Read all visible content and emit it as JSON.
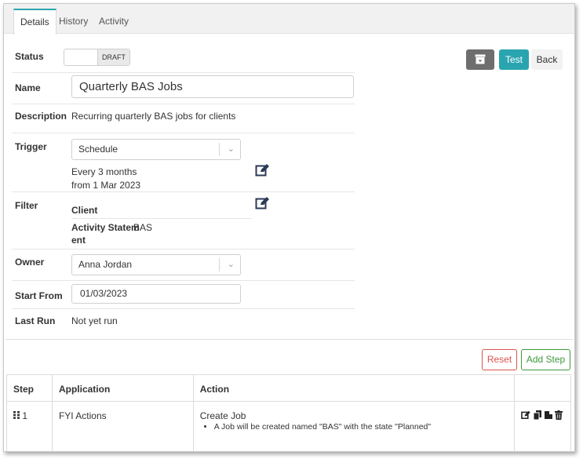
{
  "tabs": [
    {
      "label": "Details",
      "active": true
    },
    {
      "label": "History",
      "active": false
    },
    {
      "label": "Activity",
      "active": false
    }
  ],
  "form": {
    "status": {
      "label": "Status",
      "value": "DRAFT"
    },
    "name": {
      "label": "Name",
      "value": "Quarterly BAS Jobs"
    },
    "description": {
      "label": "Description",
      "value": "Recurring quarterly BAS jobs for clients"
    },
    "trigger": {
      "label": "Trigger",
      "selected": "Schedule",
      "summary_line1": "Every 3 months",
      "summary_line2": "from 1 Mar 2023"
    },
    "filter": {
      "label": "Filter",
      "field1": "Client",
      "field2_line1": "Activity Statem",
      "field2_line2": "ent",
      "field2_value": "BAS"
    },
    "owner": {
      "label": "Owner",
      "selected": "Anna Jordan"
    },
    "start_from": {
      "label": "Start From",
      "value": "01/03/2023"
    },
    "last_run": {
      "label": "Last Run",
      "value": "Not yet run"
    }
  },
  "toolbar": {
    "test_label": "Test",
    "back_label": "Back"
  },
  "steps_actions": {
    "reset_label": "Reset",
    "add_step_label": "Add Step"
  },
  "steps_table": {
    "columns": [
      "Step",
      "Application",
      "Action",
      ""
    ],
    "rows": [
      {
        "step": "1",
        "application": "FYI Actions",
        "action": "Create Job",
        "detail": "A Job will be created named \"BAS\" with the state \"Planned\""
      }
    ]
  },
  "colors": {
    "accent": "#2aa5b0",
    "danger": "#d9534f",
    "success": "#3c9a3c",
    "archive": "#6e6e6e"
  }
}
